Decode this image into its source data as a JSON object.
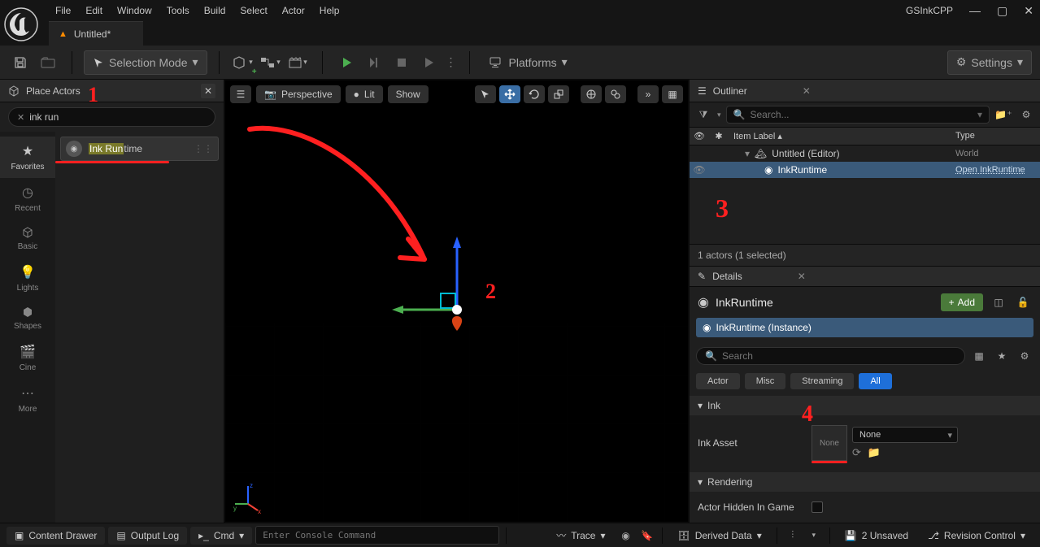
{
  "titlebar": {
    "menus": [
      "File",
      "Edit",
      "Window",
      "Tools",
      "Build",
      "Select",
      "Actor",
      "Help"
    ],
    "project": "GSInkCPP"
  },
  "tab": {
    "title": "Untitled*"
  },
  "toolbar": {
    "save_title": "Save",
    "mode_label": "Selection Mode",
    "platforms_label": "Platforms",
    "settings_label": "Settings"
  },
  "place_actors": {
    "title": "Place Actors",
    "search_value": "ink run",
    "categories": [
      {
        "name": "Favorites",
        "icon": "★"
      },
      {
        "name": "Recent",
        "icon": "◷"
      },
      {
        "name": "Basic",
        "icon": "⬚"
      },
      {
        "name": "Lights",
        "icon": "💡"
      },
      {
        "name": "Shapes",
        "icon": "◆"
      },
      {
        "name": "Cine",
        "icon": "🎬"
      },
      {
        "name": "More",
        "icon": "⋯"
      }
    ],
    "result_prefix": "Ink Run",
    "result_suffix": "time"
  },
  "viewport": {
    "perspective": "Perspective",
    "lit": "Lit",
    "show": "Show"
  },
  "outliner": {
    "title": "Outliner",
    "search_placeholder": "Search...",
    "col_label": "Item Label",
    "col_type": "Type",
    "rows": [
      {
        "label": "Untitled (Editor)",
        "type": "World",
        "icon": "🌐",
        "indent": 1
      },
      {
        "label": "InkRuntime",
        "type": "Open InkRuntime",
        "icon": "◉",
        "indent": 2,
        "selected": true
      }
    ],
    "footer": "1 actors (1 selected)"
  },
  "details": {
    "title": "Details",
    "actor_name": "InkRuntime",
    "add_label": "Add",
    "component": "InkRuntime (Instance)",
    "search_placeholder": "Search",
    "filters": [
      "Actor",
      "Misc",
      "Streaming",
      "All"
    ],
    "active_filter": "All",
    "sections": {
      "ink": {
        "title": "Ink",
        "prop_label": "Ink Asset",
        "thumb_text": "None",
        "dropdown_value": "None"
      },
      "rendering": {
        "title": "Rendering",
        "prop_label": "Actor Hidden In Game"
      }
    }
  },
  "statusbar": {
    "content_drawer": "Content Drawer",
    "output_log": "Output Log",
    "cmd_label": "Cmd",
    "cmd_placeholder": "Enter Console Command",
    "trace": "Trace",
    "derived_data": "Derived Data",
    "unsaved": "2 Unsaved",
    "revision": "Revision Control"
  },
  "annotations": {
    "n1": "1",
    "n2": "2",
    "n3": "3",
    "n4": "4"
  }
}
